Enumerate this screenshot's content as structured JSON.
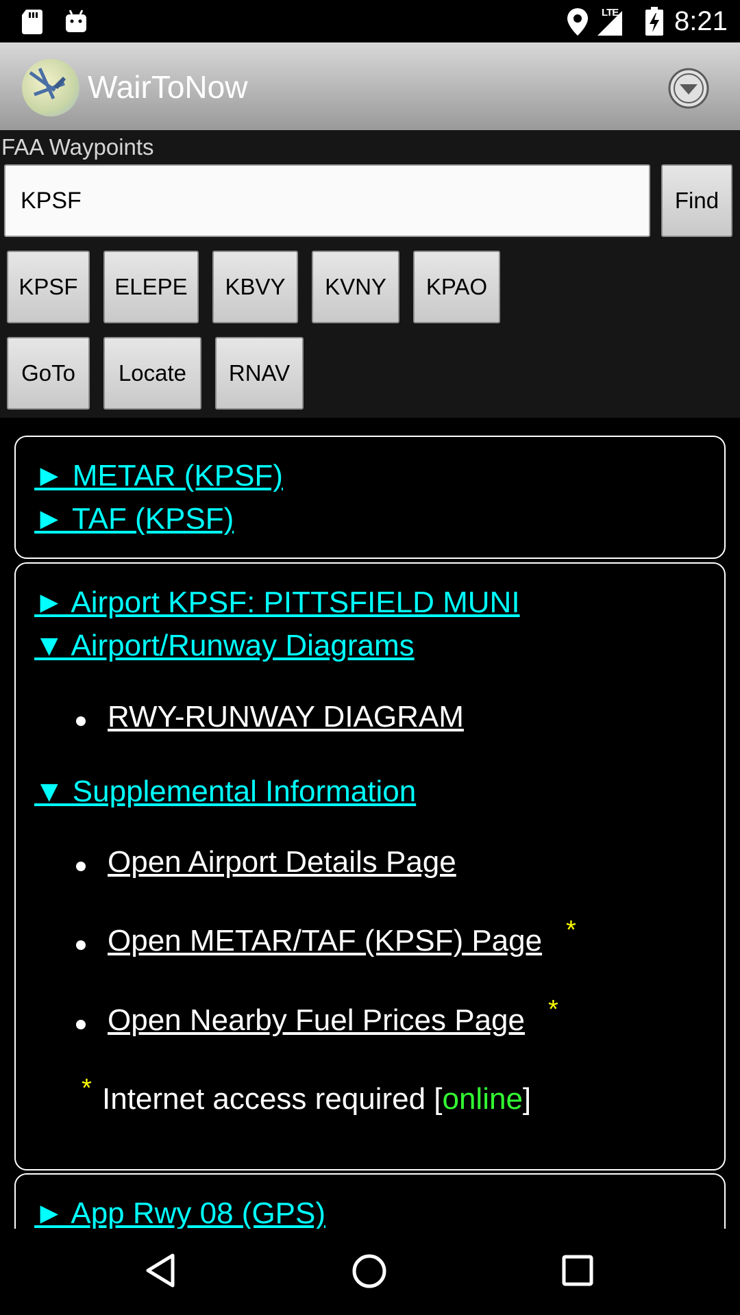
{
  "status_bar": {
    "time": "8:21",
    "network": "LTE",
    "icons": [
      "sd-card-icon",
      "android-icon",
      "location-icon",
      "signal-icon",
      "battery-charging-icon"
    ]
  },
  "app_bar": {
    "title": "WairToNow",
    "menu_icon": "dropdown-circle-icon"
  },
  "search": {
    "label": "FAA Waypoints",
    "value": "KPSF",
    "find_label": "Find"
  },
  "recent": [
    "KPSF",
    "ELEPE",
    "KBVY",
    "KVNY",
    "KPAO"
  ],
  "actions": [
    "GoTo",
    "Locate",
    "RNAV"
  ],
  "weather_card": {
    "metar": "► METAR (KPSF)",
    "taf": "► TAF (KPSF)"
  },
  "airport_card": {
    "airport": "► Airport KPSF: PITTSFIELD MUNI",
    "diagrams_heading": "▼ Airport/Runway Diagrams",
    "diagram_item": "RWY-RUNWAY DIAGRAM",
    "supplemental_heading": "▼ Supplemental Information",
    "details_link": "Open Airport Details Page",
    "metar_taf_link": "Open METAR/TAF (KPSF) Page",
    "fuel_link": "Open Nearby Fuel Prices Page",
    "star": "*",
    "note_prefix": "Internet access required [",
    "note_status": "online",
    "note_suffix": "]"
  },
  "approach_card": {
    "approach": "► App Rwy 08 (GPS)"
  },
  "colors": {
    "link": "#00ffff",
    "star": "#ffff00",
    "online": "#33ff33"
  }
}
